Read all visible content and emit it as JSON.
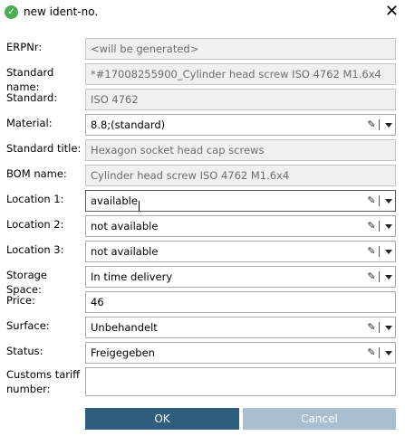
{
  "window": {
    "title": "new ident-no.",
    "close_glyph": "✕"
  },
  "form": {
    "erpnr": {
      "label": "ERPNr:",
      "value": "<will be generated>"
    },
    "standard_name": {
      "label": "Standard name:",
      "value": "*#17008255900_Cylinder head screw ISO 4762 M1.6x4"
    },
    "standard": {
      "label": "Standard:",
      "value": "ISO 4762"
    },
    "material": {
      "label": "Material:",
      "value": "8.8;(standard)"
    },
    "standard_title": {
      "label": "Standard title:",
      "value": "Hexagon socket head cap screws"
    },
    "bom_name": {
      "label": "BOM name:",
      "value": "Cylinder head screw ISO 4762 M1.6x4"
    },
    "location1": {
      "label": "Location 1:",
      "value": "available"
    },
    "location2": {
      "label": "Location 2:",
      "value": "not available"
    },
    "location3": {
      "label": "Location 3:",
      "value": "not available"
    },
    "storage_space": {
      "label": "Storage Space:",
      "value": "In time delivery"
    },
    "price": {
      "label": "Price:",
      "value": "46"
    },
    "surface": {
      "label": "Surface:",
      "value": "Unbehandelt"
    },
    "status": {
      "label": "Status:",
      "value": "Freigegeben"
    },
    "customs": {
      "label_line1": "Customs tariff",
      "label_line2": "number:",
      "value": ""
    }
  },
  "buttons": {
    "ok": "OK",
    "cancel": "Cancel"
  },
  "icons": {
    "app": "app-icon",
    "edit": "pencil-icon",
    "dropdown": "chevron-down-icon"
  },
  "colors": {
    "ok_button": "#2f5d7e",
    "cancel_button": "#a9bfd0",
    "readonly_bg": "#f0f0f0"
  }
}
